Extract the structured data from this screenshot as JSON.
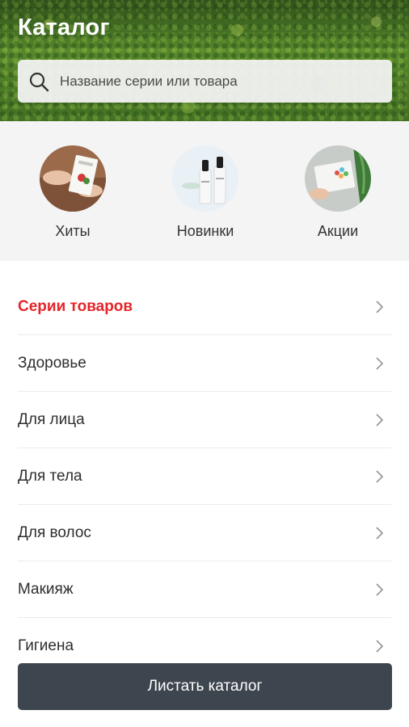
{
  "header": {
    "title": "Каталог",
    "search_placeholder": "Название серии или товара",
    "search_icon": "search-icon"
  },
  "categories": [
    {
      "label": "Хиты",
      "icon": "hits-thumbnail"
    },
    {
      "label": "Новинки",
      "icon": "new-products-thumbnail"
    },
    {
      "label": "Акции",
      "icon": "sales-thumbnail"
    }
  ],
  "menu": {
    "items": [
      {
        "label": "Серии товаров",
        "accent": true
      },
      {
        "label": "Здоровье"
      },
      {
        "label": "Для лица"
      },
      {
        "label": "Для тела"
      },
      {
        "label": "Для волос"
      },
      {
        "label": "Макияж"
      },
      {
        "label": "Гигиена"
      }
    ],
    "chevron_icon": "chevron-right-icon"
  },
  "bottom_button": {
    "label": "Листать каталог"
  },
  "colors": {
    "accent": "#e4252a",
    "button_bg": "#3d464e",
    "strip_bg": "#f4f4f4"
  }
}
